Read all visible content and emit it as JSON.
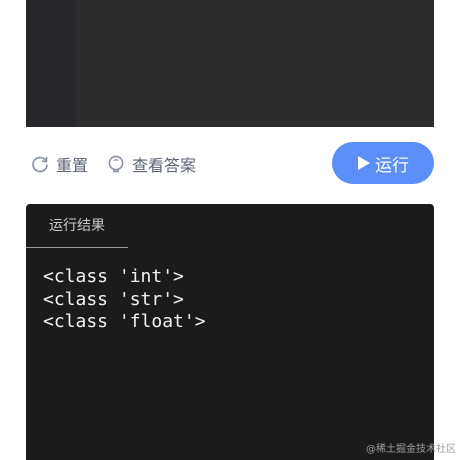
{
  "toolbar": {
    "reset_label": "重置",
    "answer_label": "查看答案",
    "run_label": "运行",
    "accent_color": "#5b8ef6"
  },
  "result": {
    "tab_label": "运行结果",
    "lines": [
      "<class 'int'>",
      "<class 'str'>",
      "<class 'float'>"
    ]
  },
  "watermark": "@稀土掘金技术社区"
}
